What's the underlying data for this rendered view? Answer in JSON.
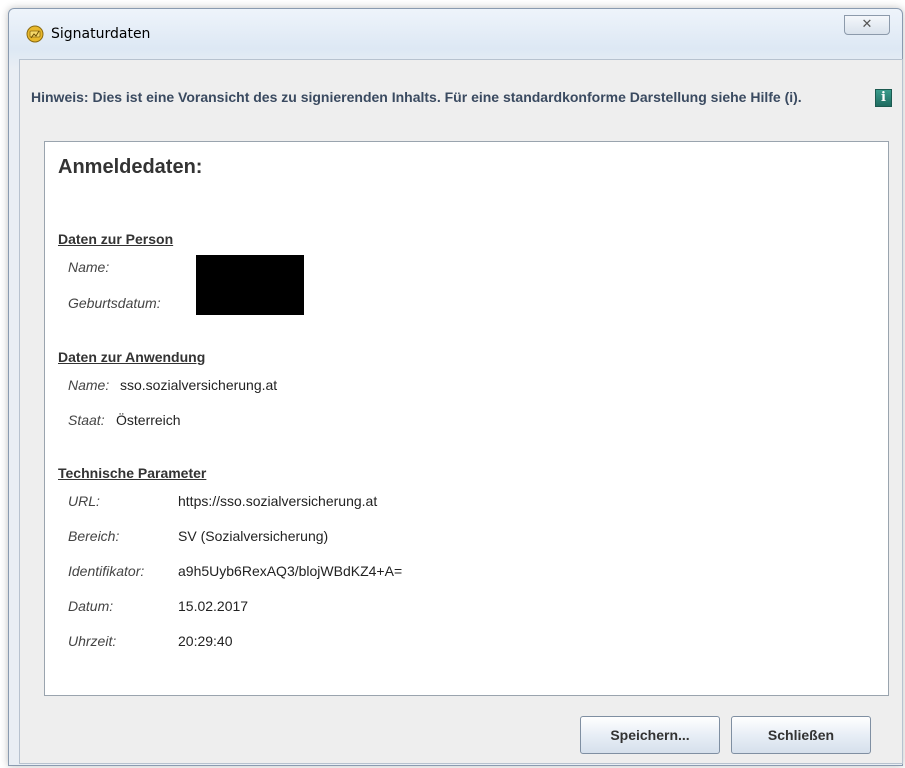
{
  "window": {
    "title": "Signaturdaten",
    "close_glyph": "✕"
  },
  "notice": {
    "text": "Hinweis: Dies ist eine Voransicht des zu signierenden Inhalts. Für eine standardkonforme Darstellung siehe Hilfe (i).",
    "info_glyph": "i"
  },
  "panel": {
    "heading": "Anmeldedaten:",
    "person": {
      "title": "Daten zur Person",
      "name_label": "Name:",
      "birth_label": "Geburtsdatum:"
    },
    "application": {
      "title": "Daten zur Anwendung",
      "name_label": "Name:",
      "name_value": "sso.sozialversicherung.at",
      "country_label": "Staat:",
      "country_value": "Österreich"
    },
    "technical": {
      "title": "Technische Parameter",
      "url_label": "URL:",
      "url_value": "https://sso.sozialversicherung.at",
      "area_label": "Bereich:",
      "area_value": "SV (Sozialversicherung)",
      "id_label": "Identifikator:",
      "id_value": "a9h5Uyb6RexAQ3/blojWBdKZ4+A=",
      "date_label": "Datum:",
      "date_value": "15.02.2017",
      "time_label": "Uhrzeit:",
      "time_value": "20:29:40"
    }
  },
  "buttons": {
    "save": "Speichern...",
    "close": "Schließen"
  }
}
